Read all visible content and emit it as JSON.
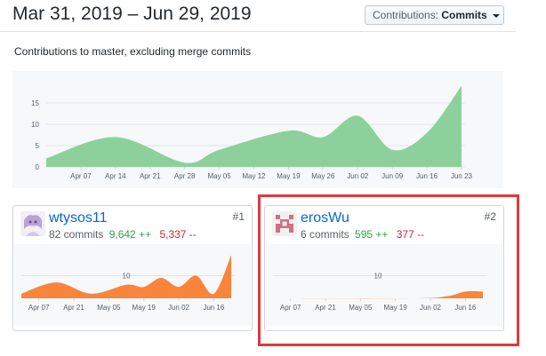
{
  "header": {
    "date_range": "Mar 31, 2019 – Jun 29, 2019",
    "contributions_button": {
      "label": "Contributions:",
      "value": "Commits"
    }
  },
  "subtitle": "Contributions to master, excluding merge commits",
  "chart_data": [
    {
      "type": "area",
      "title": "",
      "color": "#8cd19c",
      "x": [
        "Mar 31",
        "Apr 07",
        "Apr 14",
        "Apr 21",
        "Apr 28",
        "May 05",
        "May 12",
        "May 19",
        "May 26",
        "Jun 02",
        "Jun 09",
        "Jun 16",
        "Jun 23"
      ],
      "tick_labels": [
        "Apr 07",
        "Apr 14",
        "Apr 21",
        "Apr 28",
        "May 05",
        "May 12",
        "May 19",
        "May 26",
        "Jun 02",
        "Jun 09",
        "Jun 16",
        "Jun 23"
      ],
      "values": [
        2,
        7,
        1,
        4,
        8,
        9,
        7,
        12,
        4,
        8,
        19
      ],
      "points": [
        {
          "x": "Mar 31",
          "y": 2
        },
        {
          "x": "Apr 14",
          "y": 7
        },
        {
          "x": "Apr 28",
          "y": 1
        },
        {
          "x": "May 05",
          "y": 4
        },
        {
          "x": "May 19",
          "y": 8.5
        },
        {
          "x": "May 26",
          "y": 7
        },
        {
          "x": "Jun 02",
          "y": 12
        },
        {
          "x": "Jun 09",
          "y": 4
        },
        {
          "x": "Jun 16",
          "y": 8
        },
        {
          "x": "Jun 23",
          "y": 19
        }
      ],
      "y_ticks": [
        0,
        5,
        10,
        15
      ],
      "ylim": [
        0,
        20
      ],
      "grid": true
    },
    {
      "type": "area",
      "title": "",
      "color": "#f9843b",
      "points": [
        {
          "x": "Mar 31",
          "y": 2
        },
        {
          "x": "Apr 14",
          "y": 7
        },
        {
          "x": "Apr 28",
          "y": 2
        },
        {
          "x": "May 12",
          "y": 6
        },
        {
          "x": "May 19",
          "y": 5
        },
        {
          "x": "May 26",
          "y": 9
        },
        {
          "x": "Jun 02",
          "y": 5
        },
        {
          "x": "Jun 09",
          "y": 10
        },
        {
          "x": "Jun 16",
          "y": 2
        },
        {
          "x": "Jun 23",
          "y": 19
        }
      ],
      "tick_labels": [
        "Apr 07",
        "Apr 21",
        "May 05",
        "May 19",
        "Jun 02",
        "Jun 16"
      ],
      "y_ticks": [
        10
      ],
      "ylim": [
        0,
        20
      ]
    },
    {
      "type": "area",
      "title": "",
      "color": "#f9843b",
      "points": [
        {
          "x": "Mar 31",
          "y": 0
        },
        {
          "x": "May 26",
          "y": 0
        },
        {
          "x": "Jun 09",
          "y": 1
        },
        {
          "x": "Jun 16",
          "y": 3
        },
        {
          "x": "Jun 23",
          "y": 3
        }
      ],
      "tick_labels": [
        "Apr 07",
        "Apr 21",
        "May 05",
        "May 19",
        "Jun 02",
        "Jun 16"
      ],
      "y_ticks": [
        10
      ],
      "ylim": [
        0,
        20
      ]
    }
  ],
  "contributors": [
    {
      "name": "wtysos11",
      "rank": "#1",
      "commits": "82 commits",
      "additions": "9,642 ++",
      "deletions": "5,337 --"
    },
    {
      "name": "erosWu",
      "rank": "#2",
      "commits": "6 commits",
      "additions": "595 ++",
      "deletions": "377 --"
    }
  ],
  "colors": {
    "main_area": "#8cd19c",
    "contributor_area": "#f9843b",
    "highlight": "#e0393e",
    "link": "#0366d6"
  }
}
